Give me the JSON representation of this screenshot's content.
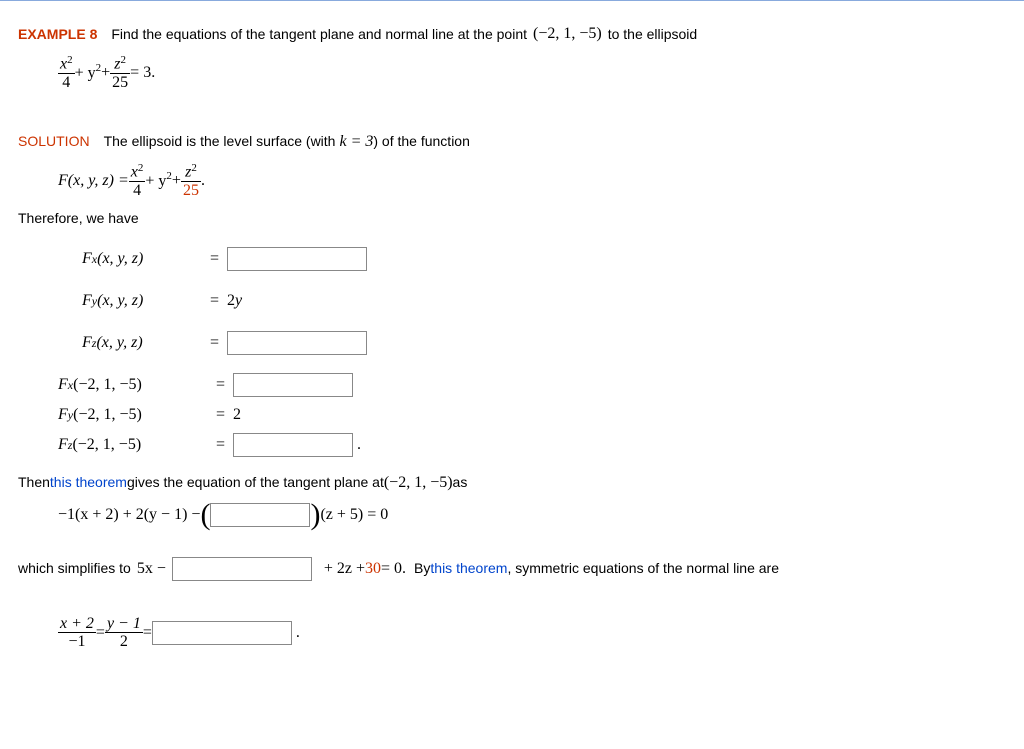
{
  "heading": {
    "label": "EXAMPLE 8",
    "prompt_a": "Find the equations of the tangent plane and normal line at the point",
    "point": "(−2, 1, −5)",
    "prompt_b": "to the ellipsoid"
  },
  "eq1": {
    "f1n": "x",
    "f1d": "4",
    "mid": " + y",
    "plus": " + ",
    "f2n": "z",
    "f2d": "25",
    "rhs": " = 3."
  },
  "solution": {
    "label": "SOLUTION",
    "text_a": "The ellipsoid is the level surface (with",
    "k_eq": "k = 3",
    "text_b": ") of the function"
  },
  "Fdef": {
    "lhs": "F(x, y, z) = ",
    "f1n": "x",
    "f1d": "4",
    "mid": " + y",
    "plus": " + ",
    "f2n": "z",
    "f2d": "25"
  },
  "therefore": "Therefore, we have",
  "Fx": {
    "lhs": "F",
    "sub": "x",
    "args": "(x, y, z)"
  },
  "Fy": {
    "lhs": "F",
    "sub": "y",
    "args": "(x, y, z)",
    "val": "2y"
  },
  "Fz": {
    "lhs": "F",
    "sub": "z",
    "args": "(x, y, z)"
  },
  "Fxp": {
    "lhs": "F",
    "sub": "x",
    "args": "(−2, 1, −5)"
  },
  "Fyp": {
    "lhs": "F",
    "sub": "y",
    "args": "(−2, 1, −5)",
    "val": "2"
  },
  "Fzp": {
    "lhs": "F",
    "sub": "z",
    "args": "(−2, 1, −5)"
  },
  "then": {
    "a": "Then ",
    "link": "this theorem",
    "b": " gives the equation of the tangent plane at ",
    "pt": "(−2, 1, −5)",
    "c": " as"
  },
  "plane": {
    "lhs": "−1(x + 2) + 2(y − 1) − ",
    "rhs": "(z + 5) = 0"
  },
  "simplify": {
    "a": "which simplifies to",
    "b": "5x −",
    "c": "+ 2z + ",
    "const": "30",
    "d": " = 0.",
    "e": "By ",
    "link": "this theorem",
    "f": ", symmetric equations of the normal line are"
  },
  "normal": {
    "f1n": "x + 2",
    "f1d": "−1",
    "eq": " = ",
    "f2n": "y − 1",
    "f2d": "2",
    "eq2": " = "
  }
}
